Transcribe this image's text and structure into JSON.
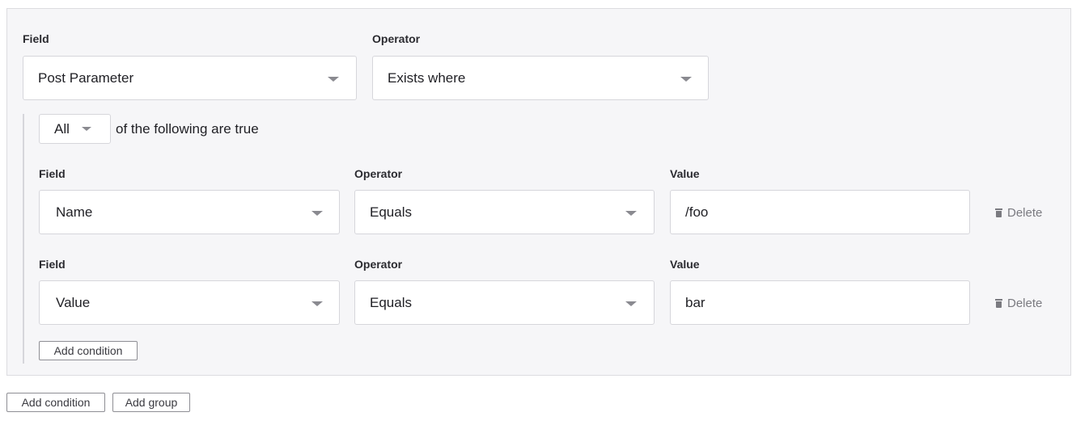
{
  "outer": {
    "field_label": "Field",
    "operator_label": "Operator",
    "field_value": "Post Parameter",
    "operator_value": "Exists where"
  },
  "group": {
    "mode_value": "All",
    "mode_text": "of the following are true",
    "conditions": [
      {
        "field_label": "Field",
        "operator_label": "Operator",
        "value_label": "Value",
        "field_value": "Name",
        "operator_value": "Equals",
        "value": "/foo",
        "delete_label": "Delete"
      },
      {
        "field_label": "Field",
        "operator_label": "Operator",
        "value_label": "Value",
        "field_value": "Value",
        "operator_value": "Equals",
        "value": "bar",
        "delete_label": "Delete"
      }
    ],
    "add_condition_label": "Add condition"
  },
  "footer": {
    "add_condition_label": "Add condition",
    "add_group_label": "Add group"
  },
  "icons": {
    "dropdown": "chevron-down-icon",
    "delete": "trash-icon"
  }
}
